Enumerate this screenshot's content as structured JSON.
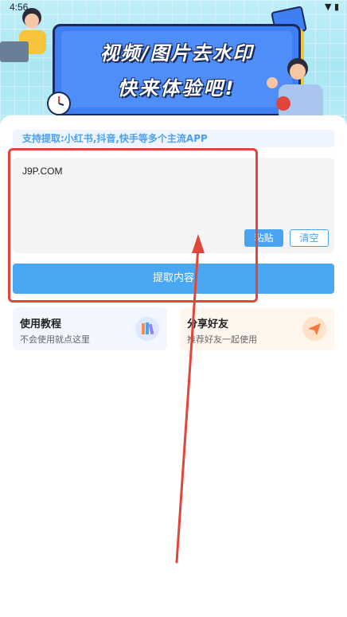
{
  "status_bar": {
    "time": "4:56"
  },
  "banner": {
    "line1": "视频/图片去水印",
    "line2": "快来体验吧!"
  },
  "support_text": "支持提取:小红书,抖音,快手等多个主流APP",
  "input": {
    "value": "J9P.COM"
  },
  "buttons": {
    "paste": "粘贴",
    "clear": "清空",
    "extract": "提取内容"
  },
  "tiles": {
    "tutorial": {
      "title": "使用教程",
      "subtitle": "不会使用就点这里",
      "icon": "books-icon"
    },
    "share": {
      "title": "分享好友",
      "subtitle": "推荐好友一起使用",
      "icon": "paper-plane-icon"
    }
  },
  "colors": {
    "accent": "#4aa3f0",
    "annotation": "#e0463a",
    "banner_bg": "#a9e7f3"
  }
}
